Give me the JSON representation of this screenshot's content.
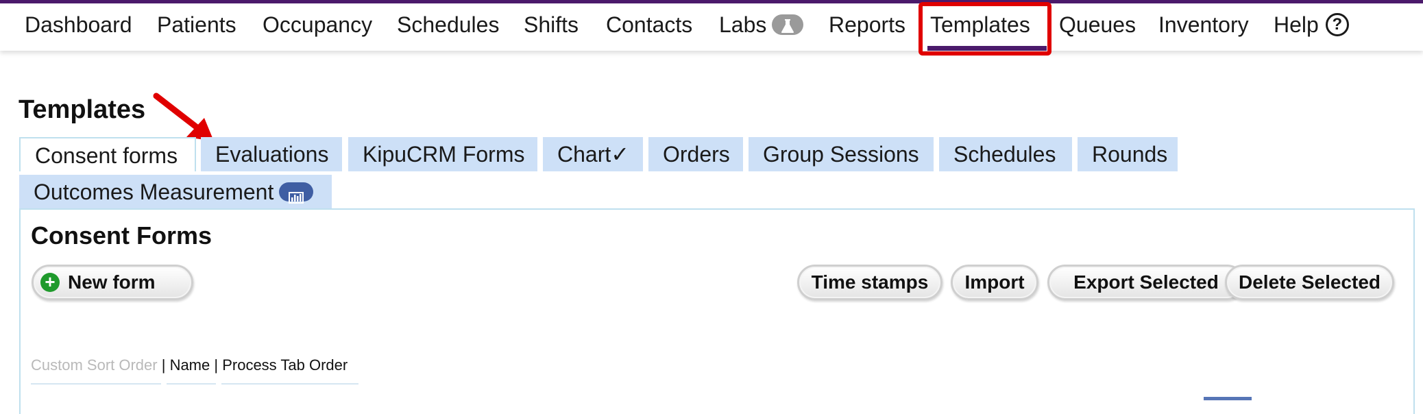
{
  "nav": {
    "items": [
      {
        "id": "dashboard",
        "label": "Dashboard"
      },
      {
        "id": "patients",
        "label": "Patients"
      },
      {
        "id": "occupancy",
        "label": "Occupancy"
      },
      {
        "id": "schedules",
        "label": "Schedules"
      },
      {
        "id": "shifts",
        "label": "Shifts"
      },
      {
        "id": "contacts",
        "label": "Contacts"
      },
      {
        "id": "labs",
        "label": "Labs",
        "icon": "flask-icon"
      },
      {
        "id": "reports",
        "label": "Reports"
      },
      {
        "id": "templates",
        "label": "Templates",
        "active": true
      },
      {
        "id": "queues",
        "label": "Queues"
      },
      {
        "id": "inventory",
        "label": "Inventory"
      },
      {
        "id": "help",
        "label": "Help",
        "icon": "question-circle-icon"
      }
    ]
  },
  "page": {
    "title": "Templates"
  },
  "tabs": [
    {
      "id": "consent-forms",
      "label": "Consent forms",
      "active": true
    },
    {
      "id": "evaluations",
      "label": "Evaluations"
    },
    {
      "id": "kipucrm-forms",
      "label": "KipuCRM Forms"
    },
    {
      "id": "chart",
      "label": "Chart✓"
    },
    {
      "id": "orders",
      "label": "Orders"
    },
    {
      "id": "group-sessions",
      "label": "Group Sessions"
    },
    {
      "id": "schedules",
      "label": "Schedules"
    },
    {
      "id": "rounds",
      "label": "Rounds"
    },
    {
      "id": "outcomes-measurement",
      "label": "Outcomes Measurement",
      "icon": "bar-chart-icon"
    }
  ],
  "section": {
    "title": "Consent Forms"
  },
  "buttons": {
    "new_form": "New form",
    "time_stamps": "Time stamps",
    "import": "Import",
    "export_selected": "Export Selected",
    "delete_selected": "Delete Selected"
  },
  "sort": {
    "custom_sort_order": "Custom Sort Order",
    "separator": " | ",
    "name": "Name",
    "process_tab_order": "Process Tab Order"
  },
  "colors": {
    "brand": "#4b1a6b",
    "highlight": "#e00000",
    "tab_bg": "#cde0f7",
    "badge": "#3f5ea3",
    "add_green": "#1f9a2c"
  }
}
